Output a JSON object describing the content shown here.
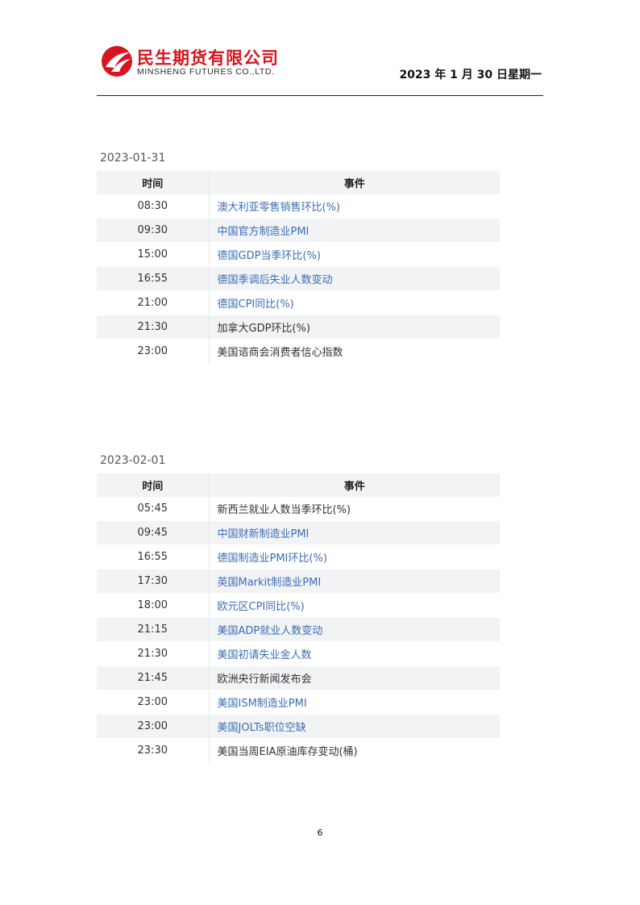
{
  "header": {
    "company_cn": "民生期货有限公司",
    "company_en": "MINSHENG FUTURES CO.,LTD.",
    "report_date": "2023 年 1 月 30 日星期一"
  },
  "colors": {
    "brand_red": "#d7151f",
    "link_blue": "#3b6db4",
    "row_stripe": "#f2f3f5"
  },
  "table_headers": {
    "time": "时间",
    "event": "事件"
  },
  "sections": [
    {
      "date": "2023-01-31",
      "rows": [
        {
          "time": "08:30",
          "event": "澳大利亚零售销售环比(%)",
          "link": true
        },
        {
          "time": "09:30",
          "event": "中国官方制造业PMI",
          "link": true
        },
        {
          "time": "15:00",
          "event": "德国GDP当季环比(%)",
          "link": true
        },
        {
          "time": "16:55",
          "event": "德国季调后失业人数变动",
          "link": true
        },
        {
          "time": "21:00",
          "event": "德国CPI同比(%)",
          "link": true
        },
        {
          "time": "21:30",
          "event": "加拿大GDP环比(%)",
          "link": false
        },
        {
          "time": "23:00",
          "event": "美国谘商会消费者信心指数",
          "link": false
        }
      ]
    },
    {
      "date": "2023-02-01",
      "rows": [
        {
          "time": "05:45",
          "event": "新西兰就业人数当季环比(%)",
          "link": false
        },
        {
          "time": "09:45",
          "event": "中国财新制造业PMI",
          "link": true
        },
        {
          "time": "16:55",
          "event": "德国制造业PMI环比(%)",
          "link": true
        },
        {
          "time": "17:30",
          "event": "英国Markit制造业PMI",
          "link": true
        },
        {
          "time": "18:00",
          "event": "欧元区CPI同比(%)",
          "link": true
        },
        {
          "time": "21:15",
          "event": "美国ADP就业人数变动",
          "link": true
        },
        {
          "time": "21:30",
          "event": "美国初请失业金人数",
          "link": true
        },
        {
          "time": "21:45",
          "event": "欧洲央行新闻发布会",
          "link": false
        },
        {
          "time": "23:00",
          "event": "美国ISM制造业PMI",
          "link": true
        },
        {
          "time": "23:00",
          "event": "美国JOLTs职位空缺",
          "link": true
        },
        {
          "time": "23:30",
          "event": "美国当周EIA原油库存变动(桶)",
          "link": false
        }
      ]
    }
  ],
  "page_number": "6"
}
